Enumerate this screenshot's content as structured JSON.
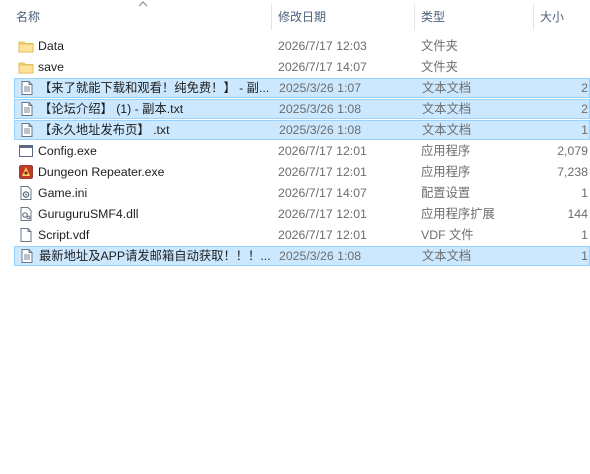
{
  "columns": {
    "name": "名称",
    "date": "修改日期",
    "type": "类型",
    "size": "大小"
  },
  "sort": {
    "column": "name",
    "direction": "ascending",
    "icon": "chevron-up-icon"
  },
  "files": [
    {
      "name": "Data",
      "date": "2026/7/17 12:03",
      "type": "文件夹",
      "size": "",
      "icon": "folder-icon",
      "selected": false
    },
    {
      "name": "save",
      "date": "2026/7/17 14:07",
      "type": "文件夹",
      "size": "",
      "icon": "folder-icon",
      "selected": false
    },
    {
      "name": "【来了就能下载和观看！纯免费！】 - 副...",
      "date": "2025/3/26 1:07",
      "type": "文本文档",
      "size": "2",
      "icon": "text-file-icon",
      "selected": true
    },
    {
      "name": "【论坛介绍】 (1) - 副本.txt",
      "date": "2025/3/26 1:08",
      "type": "文本文档",
      "size": "2",
      "icon": "text-file-icon",
      "selected": true
    },
    {
      "name": "【永久地址发布页】 .txt",
      "date": "2025/3/26 1:08",
      "type": "文本文档",
      "size": "1",
      "icon": "text-file-icon",
      "selected": true
    },
    {
      "name": "Config.exe",
      "date": "2026/7/17 12:01",
      "type": "应用程序",
      "size": "2,079",
      "icon": "app-window-icon",
      "selected": false
    },
    {
      "name": "Dungeon Repeater.exe",
      "date": "2026/7/17 12:01",
      "type": "应用程序",
      "size": "7,238",
      "icon": "game-app-icon",
      "selected": false
    },
    {
      "name": "Game.ini",
      "date": "2026/7/17 14:07",
      "type": "配置设置",
      "size": "1",
      "icon": "config-file-icon",
      "selected": false
    },
    {
      "name": "GuruguruSMF4.dll",
      "date": "2026/7/17 12:01",
      "type": "应用程序扩展",
      "size": "144",
      "icon": "dll-file-icon",
      "selected": false
    },
    {
      "name": "Script.vdf",
      "date": "2026/7/17 12:01",
      "type": "VDF 文件",
      "size": "1",
      "icon": "blank-file-icon",
      "selected": false
    },
    {
      "name": "最新地址及APP请发邮箱自动获取！！！...",
      "date": "2025/3/26 1:08",
      "type": "文本文档",
      "size": "1",
      "icon": "text-file-icon",
      "selected": true
    }
  ],
  "colors": {
    "selection_bg": "#cce8ff",
    "selection_border": "#99d1ff",
    "header_text": "#4c607a",
    "folder": "#f8d775"
  }
}
